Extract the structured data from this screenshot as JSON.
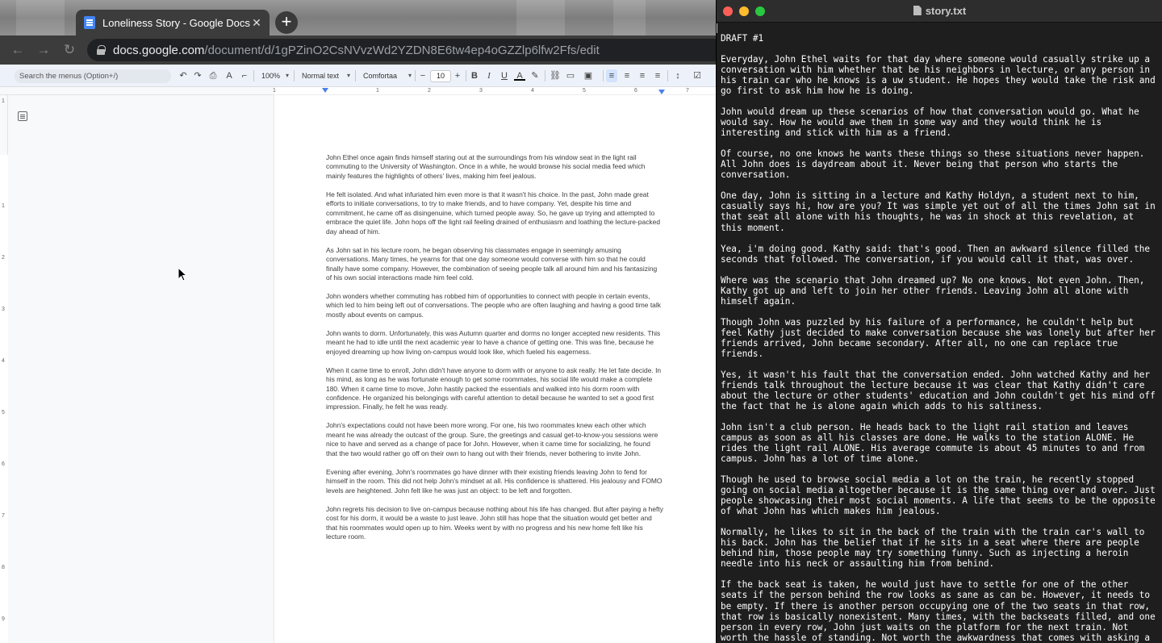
{
  "browser": {
    "tab_title": "Loneliness Story - Google Docs",
    "tab_close_glyph": "✕",
    "new_tab_glyph": "+",
    "url_host": "docs.google.com",
    "url_path": "/document/d/1gPZinO2CsNVvzWd2YZDN8E6tw4ep4oGZZlp6lfw2Ffs/edit",
    "nav": {
      "back_glyph": "←",
      "forward_glyph": "→",
      "reload_glyph": "↻"
    }
  },
  "toolbar": {
    "search_placeholder": "Search the menus (Option+/)",
    "zoom": "100%",
    "style": "Normal text",
    "font": "Comfortaa",
    "font_size": "10",
    "undo_glyph": "↶",
    "redo_glyph": "↷",
    "print_glyph": "⎙",
    "spell_glyph": "A",
    "paint_glyph": "⌐",
    "minus_glyph": "−",
    "plus_glyph": "+",
    "bold": "B",
    "italic": "I",
    "underline": "U",
    "text_color": "A",
    "highlight_glyph": "✎",
    "link_glyph": "⛓",
    "comment_glyph": "▭",
    "image_glyph": "▣",
    "align_left_glyph": "≡",
    "align_center_glyph": "≡",
    "align_right_glyph": "≡",
    "align_justify_glyph": "≡",
    "line_spacing_glyph": "↕",
    "checklist_glyph": "☑"
  },
  "ruler": {
    "h_ticks": [
      "1",
      "1",
      "2",
      "3",
      "4",
      "5",
      "6",
      "7"
    ],
    "v_ticks": [
      "1",
      "1",
      "2",
      "3",
      "4",
      "5",
      "6",
      "7",
      "8",
      "9"
    ]
  },
  "doc": {
    "paragraphs": [
      "John Ethel once again finds himself staring out at the surroundings from his window seat in the light rail commuting to the University of Washington. Once in a while, he would browse his social media feed which mainly features the highlights of others' lives, making him feel jealous.",
      "He felt isolated. And what infuriated him even more is that it wasn't his choice. In the past, John made great efforts to initiate conversations, to try to make friends, and to have company. Yet, despite his time and commitment, he came off as disingenuine, which turned people away. So, he gave up trying and attempted to embrace the quiet life. John hops off the light rail feeling drained of enthusiasm and loathing the lecture-packed day ahead of him.",
      "As John sat in his lecture room, he began observing his classmates engage in seemingly amusing conversations. Many times, he yearns for that one day someone would converse with him so that he could finally have some company. However, the combination of seeing people talk all around him and his fantasizing of his own social interactions made him feel cold.",
      "John wonders whether commuting has robbed him of opportunities to connect with people in certain events, which led to him being left out of conversations. The people who are often laughing and having a good time talk mostly about events on campus.",
      "John wants to dorm. Unfortunately, this was Autumn quarter and dorms no longer accepted new residents. This meant he had to idle until the next academic year to have a chance of getting one. This was fine, because he enjoyed dreaming up how living on-campus would look like, which fueled his eagerness.",
      "When it came time to enroll, John didn't have anyone to dorm with or anyone to ask really. He let fate decide. In his mind, as long as he was fortunate enough to get some roommates, his social life would make a complete 180. When it came time to move, John hastily packed the essentials and walked into his dorm room with confidence. He organized his belongings with careful attention to detail because he wanted to set a good first impression. Finally, he felt he was ready.",
      "John's expectations could not have been more wrong. For one, his two roommates knew each other which meant he was already the outcast of the group. Sure, the greetings and casual get-to-know-you sessions were nice to have and served as a change of pace for John. However, when it came time for socializing, he found that the two would rather go off on their own to hang out with their friends, never bothering to invite John.",
      "Evening after evening, John's roommates go have dinner with their existing friends leaving John to fend for himself in the room. This did not help John's mindset at all. His confidence is shattered. His jealousy and FOMO levels are heightened. John felt like he was just an object: to be left and forgotten.",
      "John regrets his decision to live on-campus because nothing about his life has changed. But after paying a hefty cost for his dorm, it would be a waste to just leave. John still has hope that the situation would get better and that his roommates would open up to him. Weeks went by with no progress and his new home felt like his lecture room."
    ]
  },
  "textedit": {
    "title": "story.txt",
    "paragraphs": [
      "DRAFT #1",
      "Everyday, John Ethel waits for that day where someone would casually strike up a conversation with him whether that be his neighbors in lecture, or any person in his train car who he knows is a uw student. He hopes they would take the risk and go first to ask him how he is doing.",
      "John would dream up these scenarios of how that conversation would go. What he would say. How he would awe them in some way and they would think he is interesting and stick with him as a friend.",
      "Of course, no one knows he wants these things so these situations never happen. All John does is daydream about it. Never being that person who starts the conversation.",
      "One day, John is sitting in a lecture and Kathy Holdyn, a student next to him, casually says hi, how are you? It was simple yet out of all the times John sat in that seat all alone with his thoughts, he was in shock at this revelation, at this moment.",
      "Yea, i'm doing good. Kathy said: that's good. Then an awkward silence filled the seconds that followed. The conversation, if you would call it that, was over.",
      "Where was the scenario that John dreamed up? No one knows. Not even John. Then, Kathy got up and left to join her other friends. Leaving John all alone with himself again.",
      "Though John was puzzled by his failure of a performance, he couldn't help but feel Kathy just decided to make conversation because she was lonely but after her friends arrived, John became secondary. After all, no one can replace true friends.",
      "Yes, it wasn't his fault that the conversation ended. John watched Kathy and her friends talk throughout the lecture because it was clear that Kathy didn't care about the lecture or other students' education and John couldn't get his mind off the fact that he is alone again which adds to his saltiness.",
      "John isn't a club person. He heads back to the light rail station and leaves campus as soon as all his classes are done. He walks to the station ALONE. He rides the light rail ALONE. His average commute is about 45 minutes to and from campus. John has a lot of time alone.",
      "Though he used to browse social media a lot on the train, he recently stopped going on social media altogether because it is the same thing over and over. Just people showcasing their most social moments. A life that seems to be the opposite of what John has which makes him jealous.",
      "Normally, he likes to sit in the back of the train with the train car's wall to his back. John has the belief that if he sits in a seat where there are people behind him, those people may try something funny. Such as injecting a heroin needle into his neck or assaulting him from behind.",
      "If the back seat is taken, he would just have to settle for one of the other seats if the person behind the row looks as sane as can be. However, it needs to be empty. If there is another person occupying one of the two seats in that row, that row is basically nonexistent. Many times, with the backseats filled, and one person in every row, John just waits on the platform for the next train. Not worth the hassle of standing. Not worth the awkwardness that comes with asking a"
    ]
  },
  "colors": {
    "docs_blue": "#4285f4",
    "close": "#ff5f57",
    "minimize": "#febc2e",
    "maximize": "#28c840",
    "editor_bg": "#1e1e1e",
    "doc_text": "#3c3c3c"
  }
}
